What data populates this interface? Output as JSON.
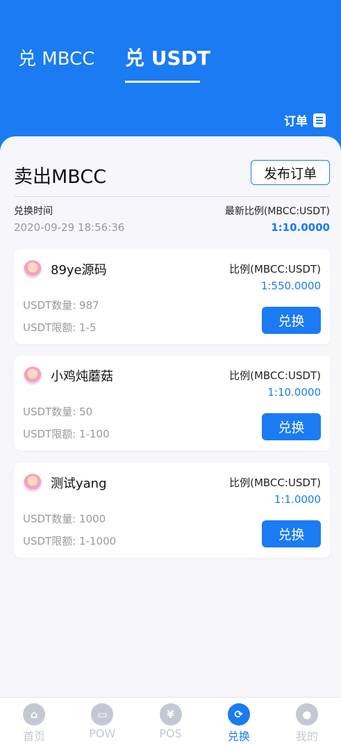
{
  "header": {
    "tabs": [
      {
        "label": "兑 MBCC",
        "active": false
      },
      {
        "label": "兑 USDT",
        "active": true
      }
    ],
    "order_label": "订单",
    "accent_color": "#1b7bf3"
  },
  "summary": {
    "title": "卖出MBCC",
    "publish_label": "发布订单",
    "time_label": "兑换时间",
    "time_value": "2020-09-29 18:56:36",
    "ratio_label": "最新比例(MBCC:USDT)",
    "ratio_value": "1:10.0000"
  },
  "offers": [
    {
      "name": "89ye源码",
      "ratio_label": "比例(MBCC:USDT)",
      "ratio_value": "1:550.0000",
      "qty": "USDT数量: 987",
      "limit": "USDT限额: 1-5",
      "button": "兑换"
    },
    {
      "name": "小鸡炖蘑菇",
      "ratio_label": "比例(MBCC:USDT)",
      "ratio_value": "1:10.0000",
      "qty": "USDT数量: 50",
      "limit": "USDT限额: 1-100",
      "button": "兑换"
    },
    {
      "name": "测试yang",
      "ratio_label": "比例(MBCC:USDT)",
      "ratio_value": "1:1.0000",
      "qty": "USDT数量: 1000",
      "limit": "USDT限额: 1-1000",
      "button": "兑换"
    }
  ],
  "tabbar": [
    {
      "label": "首页",
      "icon": "home-icon",
      "glyph": "⌂",
      "active": false
    },
    {
      "label": "POW",
      "icon": "wallet-icon",
      "glyph": "▭",
      "active": false
    },
    {
      "label": "POS",
      "icon": "yen-icon",
      "glyph": "¥",
      "active": false
    },
    {
      "label": "兑换",
      "icon": "exchange-icon",
      "glyph": "⟳",
      "active": true
    },
    {
      "label": "我的",
      "icon": "user-icon",
      "glyph": "●",
      "active": false
    }
  ]
}
